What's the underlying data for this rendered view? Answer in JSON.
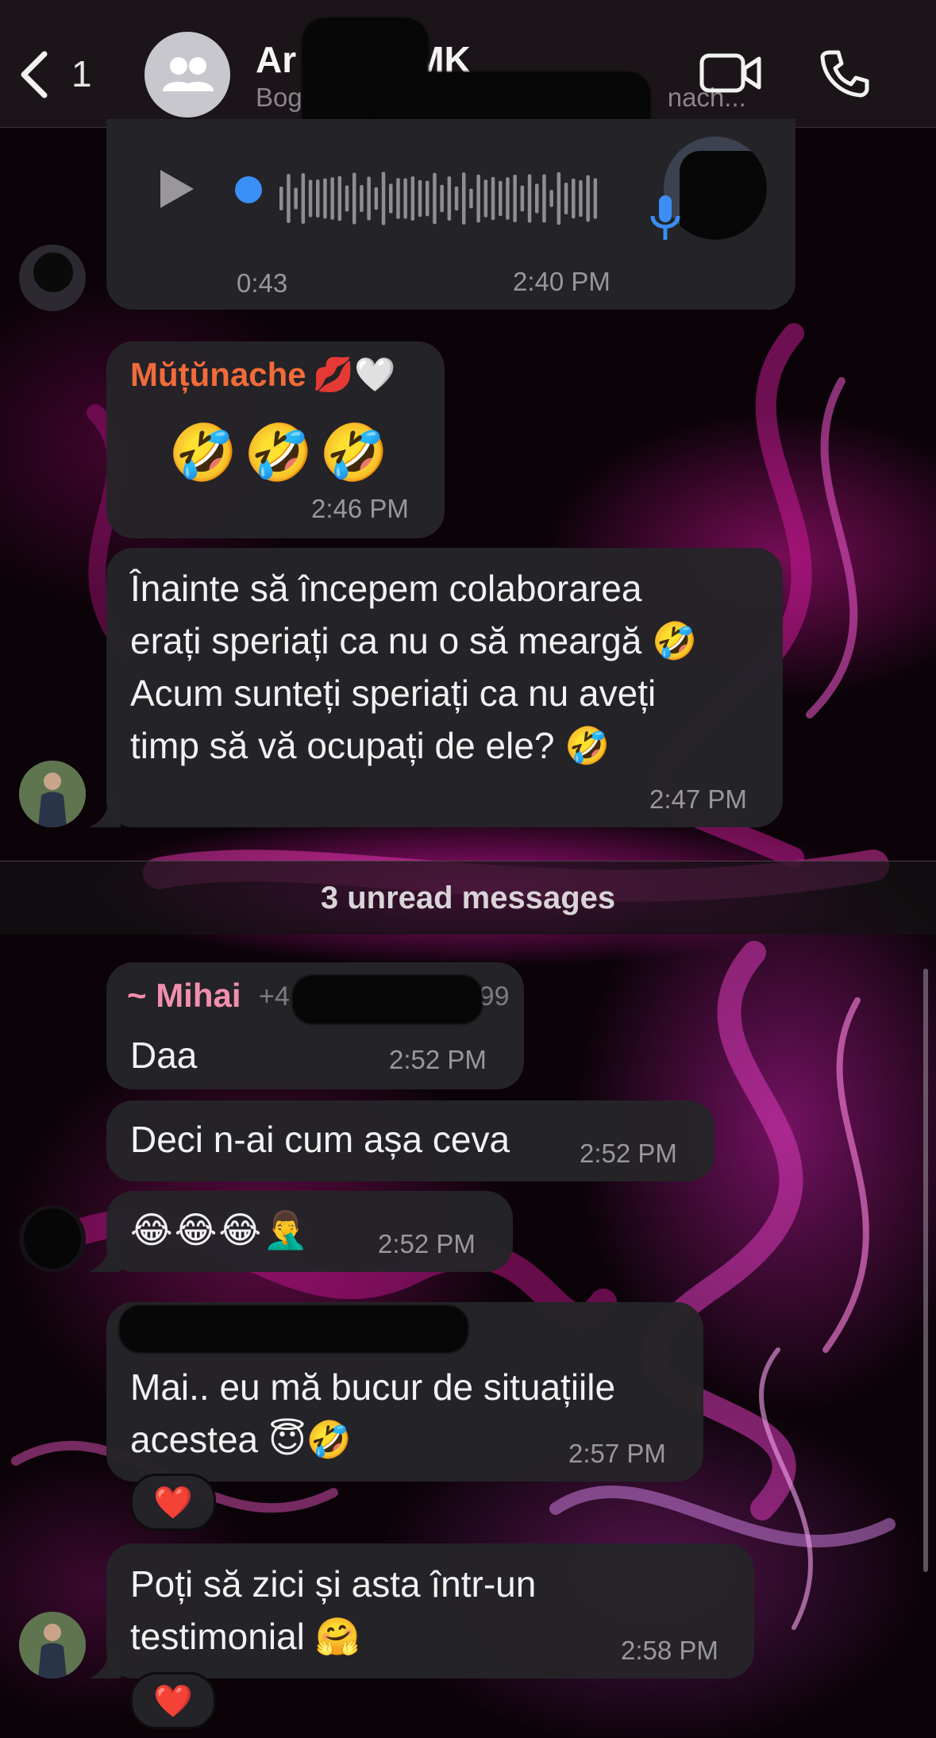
{
  "header": {
    "back_count": "1",
    "title_prefix": "Ar",
    "title_suffix": "- MK",
    "subtitle_start": "Bog",
    "subtitle_end": "nach...",
    "icons": [
      "chevron-left-icon",
      "group-icon",
      "video-camera-icon",
      "phone-icon"
    ]
  },
  "voice_message": {
    "duration": "0:43",
    "time": "2:40 PM",
    "icons": [
      "play-icon",
      "microphone-icon"
    ]
  },
  "messages": [
    {
      "sender": "Mŭțŭnache",
      "sender_emoji": "💋🤍",
      "text": "🤣🤣🤣",
      "time": "2:46 PM"
    },
    {
      "lines": [
        "Înainte să începem colaborarea",
        "erați speriați ca nu o să meargă 🤣",
        "Acum sunteți speriați ca nu aveți",
        "timp să vă ocupați de ele? 🤣"
      ],
      "time": "2:47 PM"
    }
  ],
  "unread_label": "3 unread messages",
  "unread_messages": [
    {
      "sender": "~ Mihai",
      "phone_visible": "+4",
      "phone_tail": "199",
      "text": "Daa",
      "time": "2:52 PM"
    },
    {
      "text": "Deci n-ai cum așa ceva",
      "time": "2:52 PM"
    },
    {
      "text": "😂😂😂🤦‍♂️",
      "time": "2:52 PM"
    },
    {
      "lines": [
        "Mai.. eu mă bucur de situațiile",
        "acestea 😇🤣"
      ],
      "time": "2:57 PM",
      "reaction": "❤️"
    },
    {
      "lines": [
        "Poți să zici și asta într-un",
        "testimonial 🤗"
      ],
      "time": "2:58 PM",
      "reaction": "❤️"
    }
  ],
  "colors": {
    "accent_blue": "#3a8ef5",
    "sender_orange": "#f26b3a",
    "sender_pink": "#f28fae",
    "bubble": "#252428",
    "timestamp": "#9a979c"
  }
}
